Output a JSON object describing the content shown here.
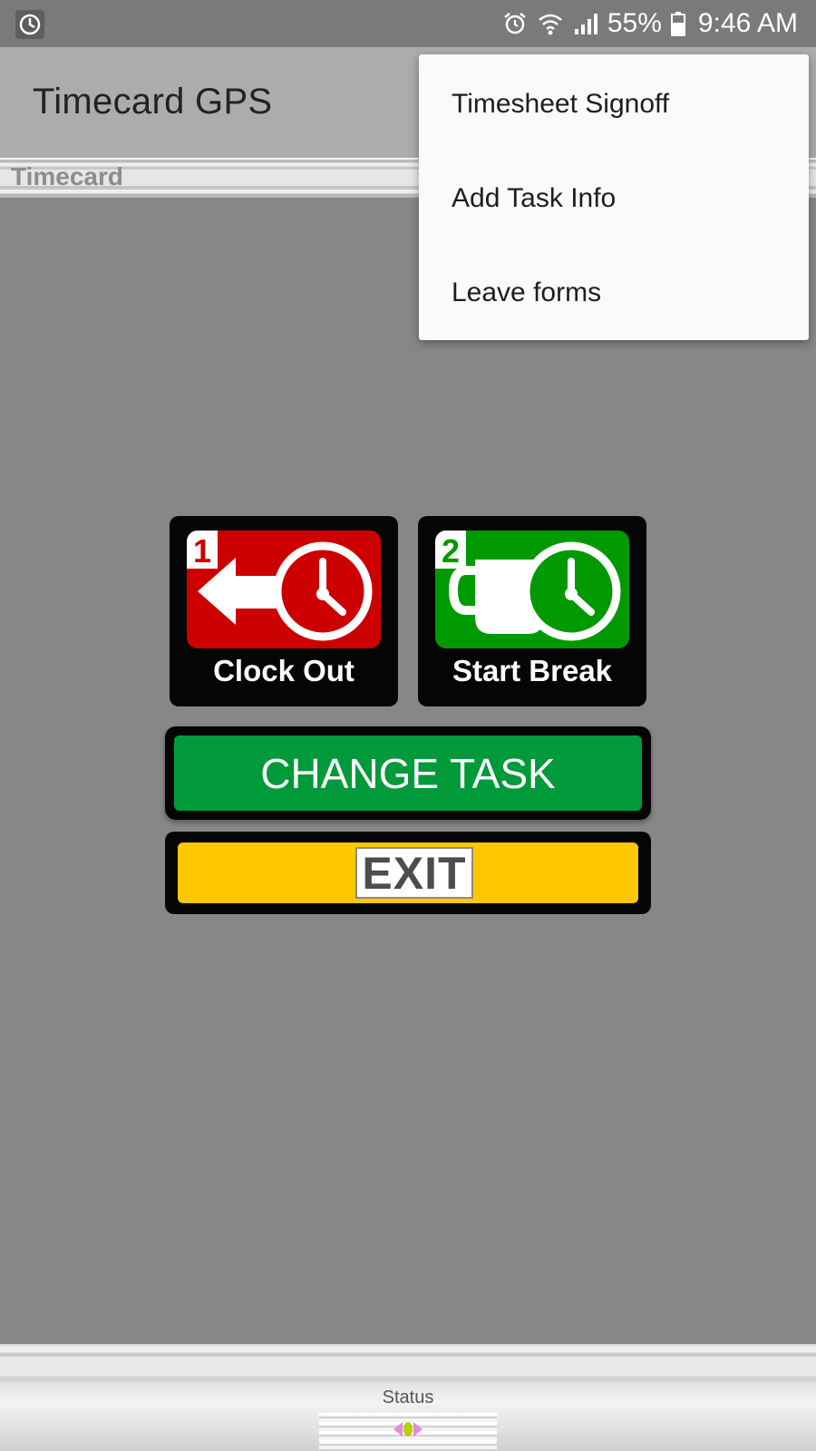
{
  "status_bar": {
    "battery": "55%",
    "time": "9:46 AM",
    "icons": [
      "clock-app-icon",
      "alarm-icon",
      "wifi-icon",
      "signal-icon",
      "battery-icon"
    ]
  },
  "app_bar": {
    "title": "Timecard GPS"
  },
  "section": {
    "label": "Timecard"
  },
  "menu": {
    "items": [
      {
        "label": "Timesheet Signoff"
      },
      {
        "label": "Add Task Info"
      },
      {
        "label": "Leave forms"
      }
    ]
  },
  "actions": {
    "clock_out": {
      "number": "1",
      "label": "Clock Out",
      "color": "#cc0000"
    },
    "start_break": {
      "number": "2",
      "label": "Start Break",
      "color": "#009900"
    },
    "change_task": {
      "label": "CHANGE TASK",
      "color": "#009a3a"
    },
    "exit": {
      "label": "EXIT",
      "color": "#ffc800"
    }
  },
  "bottom": {
    "status_label": "Status"
  }
}
